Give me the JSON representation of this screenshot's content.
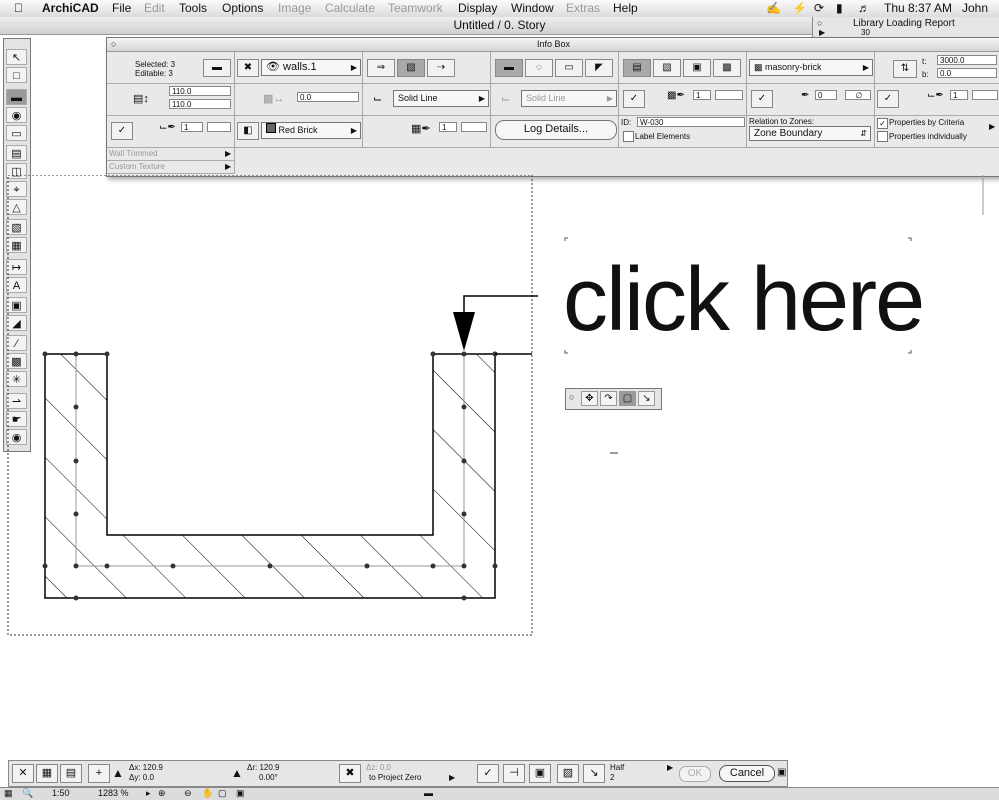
{
  "menubar": {
    "app": "ArchiCAD",
    "items": [
      {
        "label": "File",
        "enabled": true
      },
      {
        "label": "Edit",
        "enabled": false
      },
      {
        "label": "Tools",
        "enabled": true
      },
      {
        "label": "Options",
        "enabled": true
      },
      {
        "label": "Image",
        "enabled": false
      },
      {
        "label": "Calculate",
        "enabled": false
      },
      {
        "label": "Teamwork",
        "enabled": false
      },
      {
        "label": "Display",
        "enabled": true
      },
      {
        "label": "Window",
        "enabled": true
      },
      {
        "label": "Extras",
        "enabled": false
      },
      {
        "label": "Help",
        "enabled": true
      }
    ],
    "clock": "Thu 8:37 AM",
    "user": "John",
    "status_icons": [
      "script-icon",
      "bolt-icon",
      "sync-icon",
      "battery-icon",
      "volume-icon"
    ]
  },
  "window": {
    "title": "Untitled / 0. Story"
  },
  "library_panel": {
    "title": "Library Loading Report",
    "value": "30"
  },
  "infobox": {
    "title": "Info Box",
    "selected": "Selected: 3",
    "editable": "Editable: 3",
    "layer": "walls.1",
    "height_top": "110.0",
    "height_bottom": "110.0",
    "offset": "0.0",
    "line_type": "Solid Line",
    "line_type_2": "Solid Line",
    "fill": "masonry-brick",
    "top_value": "3000.0",
    "bottom_value": "0.0",
    "top_label": "t:",
    "bottom_label": "b:",
    "material": "Red Brick",
    "pen_1": "1",
    "pen_2": "1",
    "pen_3": "0",
    "pen_4": "1",
    "pen_5": "1",
    "pen_6": "1",
    "log_button": "Log Details...",
    "id_label": "ID:",
    "id_value": "W-030",
    "label_elements": "Label Elements",
    "relation_label": "Relation to Zones:",
    "relation_value": "Zone Boundary",
    "props_criteria": "Properties by Criteria",
    "props_individual": "Properties individually",
    "props_criteria_checked": true,
    "wall_trimmed": "Wall Trimmed",
    "custom_texture": "Custom Texture"
  },
  "canvas": {
    "annotation": "click here"
  },
  "control_box": {
    "dx": "Δx: 120.9",
    "dy": "Δy: 0.0",
    "dr": "Δr: 120.9",
    "da": "0.00°",
    "dz": "Δz: 0.0",
    "to_project_zero": "to Project Zero",
    "half_label": "Half",
    "half_value": "2",
    "ok_label": "OK",
    "cancel_label": "Cancel"
  },
  "statusbar": {
    "scale": "1:50",
    "zoom": "1283 %"
  }
}
